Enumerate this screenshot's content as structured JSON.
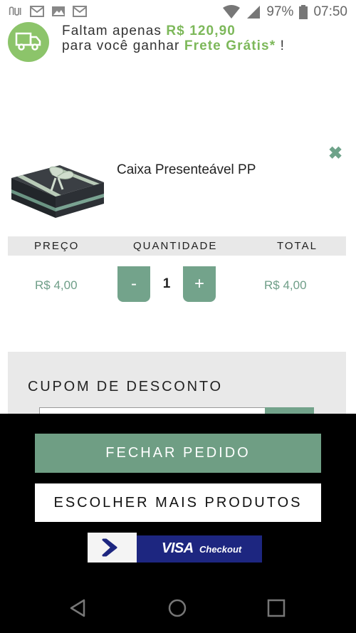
{
  "status_bar": {
    "battery": "97%",
    "time": "07:50",
    "icons": [
      "nubank-icon",
      "mail-icon",
      "image-icon",
      "mail-icon",
      "wifi-icon",
      "signal-icon",
      "battery-icon"
    ]
  },
  "shipping_banner": {
    "line1_prefix": "Faltam apenas ",
    "amount": "R$ 120,90",
    "line2_prefix": "para você ganhar ",
    "highlight": "Frete Grátis*",
    "line2_suffix": " !",
    "icon": "truck-icon"
  },
  "product": {
    "name": "Caixa Presenteável PP",
    "remove_icon": "close-icon"
  },
  "table": {
    "headers": [
      "PREÇO",
      "QUANTIDADE",
      "TOTAL"
    ],
    "price": "R$ 4,00",
    "quantity": "1",
    "total": "R$ 4,00",
    "minus": "-",
    "plus": "+"
  },
  "coupon": {
    "title": "CUPOM DE DESCONTO"
  },
  "actions": {
    "checkout_label": "FECHAR PEDIDO",
    "more_label": "ESCOLHER MAIS PRODUTOS"
  },
  "visa": {
    "brand": "VISA",
    "sub": "Checkout"
  },
  "nav": {
    "icons": [
      "back-icon",
      "home-icon",
      "recents-icon"
    ]
  },
  "colors": {
    "accent_green": "#73a38b",
    "shipping_green": "#8cc46a",
    "visa_blue": "#1d2680"
  }
}
